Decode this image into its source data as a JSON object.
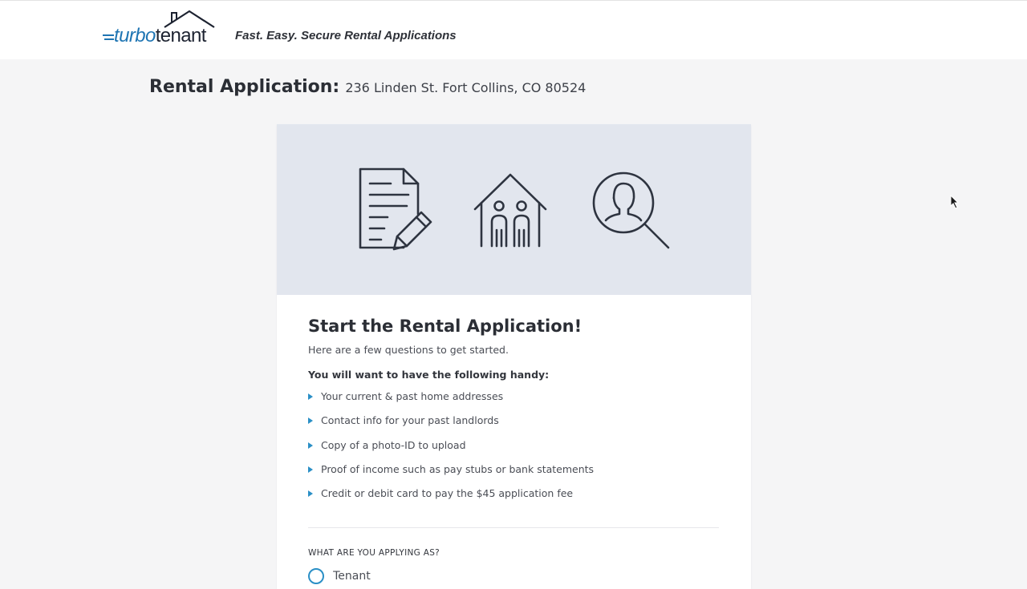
{
  "header": {
    "logo": {
      "part1": "turbo",
      "part2": "tenant"
    },
    "tagline": "Fast. Easy. Secure Rental Applications"
  },
  "page": {
    "title_label": "Rental Application:",
    "address": "236 Linden St. Fort Collins, CO 80524"
  },
  "banner": {
    "icons": [
      "document-edit-icon",
      "family-house-icon",
      "person-search-icon"
    ]
  },
  "card": {
    "title": "Start the Rental Application!",
    "intro": "Here are a few questions to get started.",
    "handy_heading": "You will want to have the following handy:",
    "items": [
      "Your current & past home addresses",
      "Contact info for your past landlords",
      "Copy of a photo-ID to upload",
      "Proof of income such as pay stubs or bank statements",
      "Credit or debit card to pay the $45 application fee"
    ],
    "applying_label": "WHAT ARE YOU APPLYING AS?",
    "options": [
      "Tenant"
    ]
  },
  "colors": {
    "accent": "#2a8fc6",
    "logo_blue": "#1f75b3",
    "banner_bg": "#e2e6ee",
    "page_bg": "#f5f5f6"
  }
}
